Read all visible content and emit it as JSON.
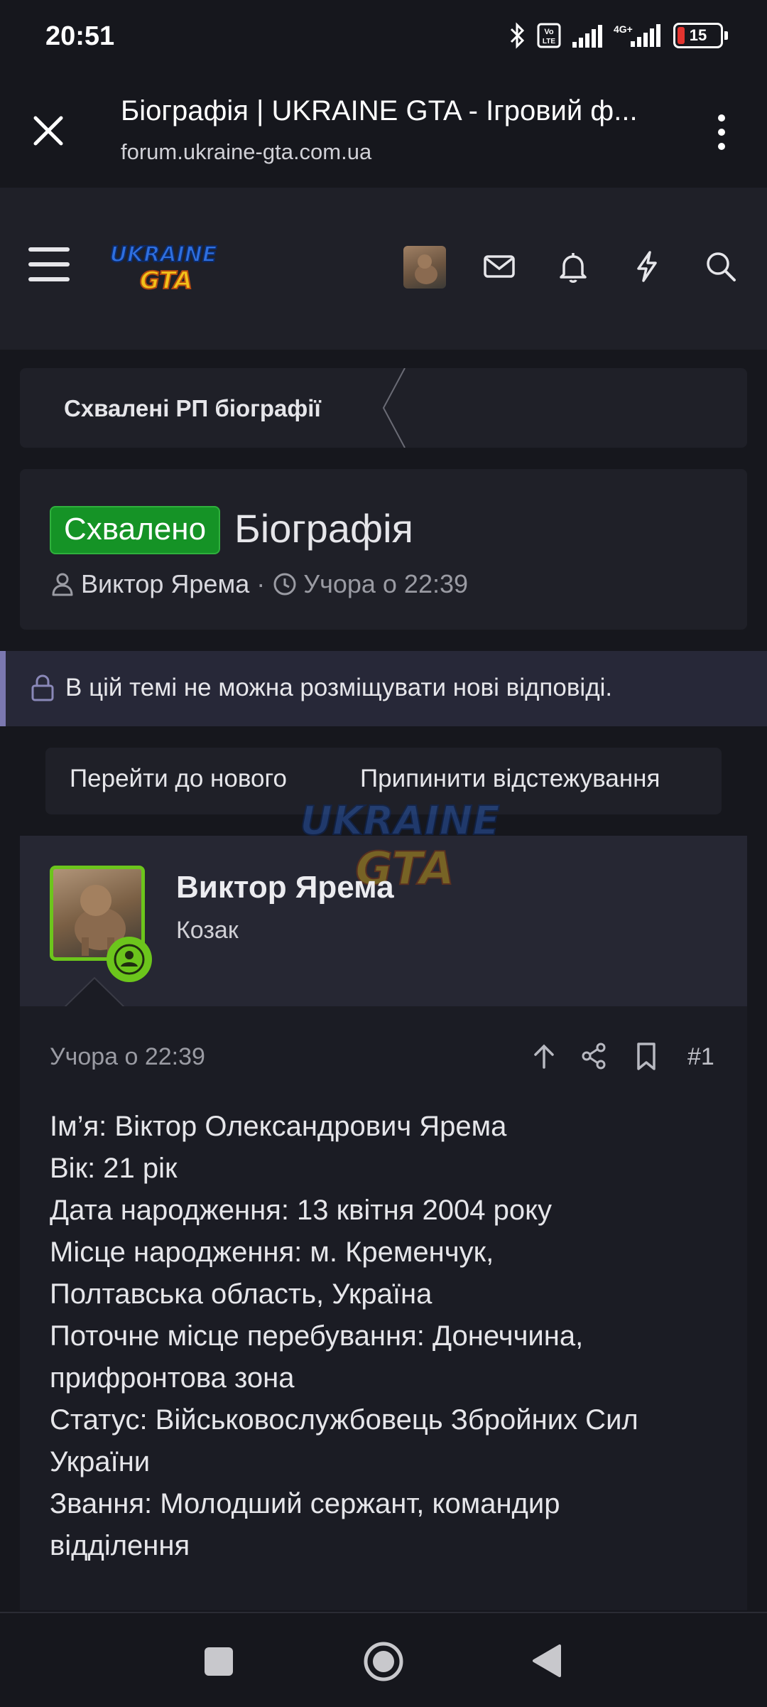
{
  "status_bar": {
    "time": "20:51",
    "battery": "15",
    "network": "4G+"
  },
  "browser": {
    "title": "Біографія | UKRAINE GTA - Ігровий ф...",
    "url": "forum.ukraine-gta.com.ua"
  },
  "header": {
    "logo_top": "UKRAINE",
    "logo_bottom": "GTA"
  },
  "breadcrumb": {
    "label": "Схвалені РП біографії"
  },
  "thread": {
    "badge": "Схвалено",
    "title": "Біографія",
    "author": "Виктор Ярема",
    "separator": "·",
    "time": "Учора о 22:39"
  },
  "notice": {
    "text": "В цій темі не можна розміщувати нові відповіді."
  },
  "buttons": {
    "goto_new": "Перейти до нового",
    "unwatch": "Припинити відстежування"
  },
  "post": {
    "username": "Виктор Ярема",
    "user_title": "Козак",
    "date": "Учора о 22:39",
    "number": "#1",
    "lines": [
      "Ім’я: Віктор Олександрович Ярема",
      "Вік: 21 рік",
      "Дата народження: 13 квітня 2004 року",
      "Місце народження: м. Кременчук,",
      "Полтавська область, Україна",
      "Поточне місце перебування: Донеччина,",
      "прифронтова зона",
      "Статус: Військовослужбовець Збройних Сил",
      "України",
      "Звання: Молодший сержант, командир",
      "відділення"
    ]
  },
  "colors": {
    "approved": "#159326",
    "online": "#6cc51c",
    "notice_border": "#7b78b0"
  }
}
